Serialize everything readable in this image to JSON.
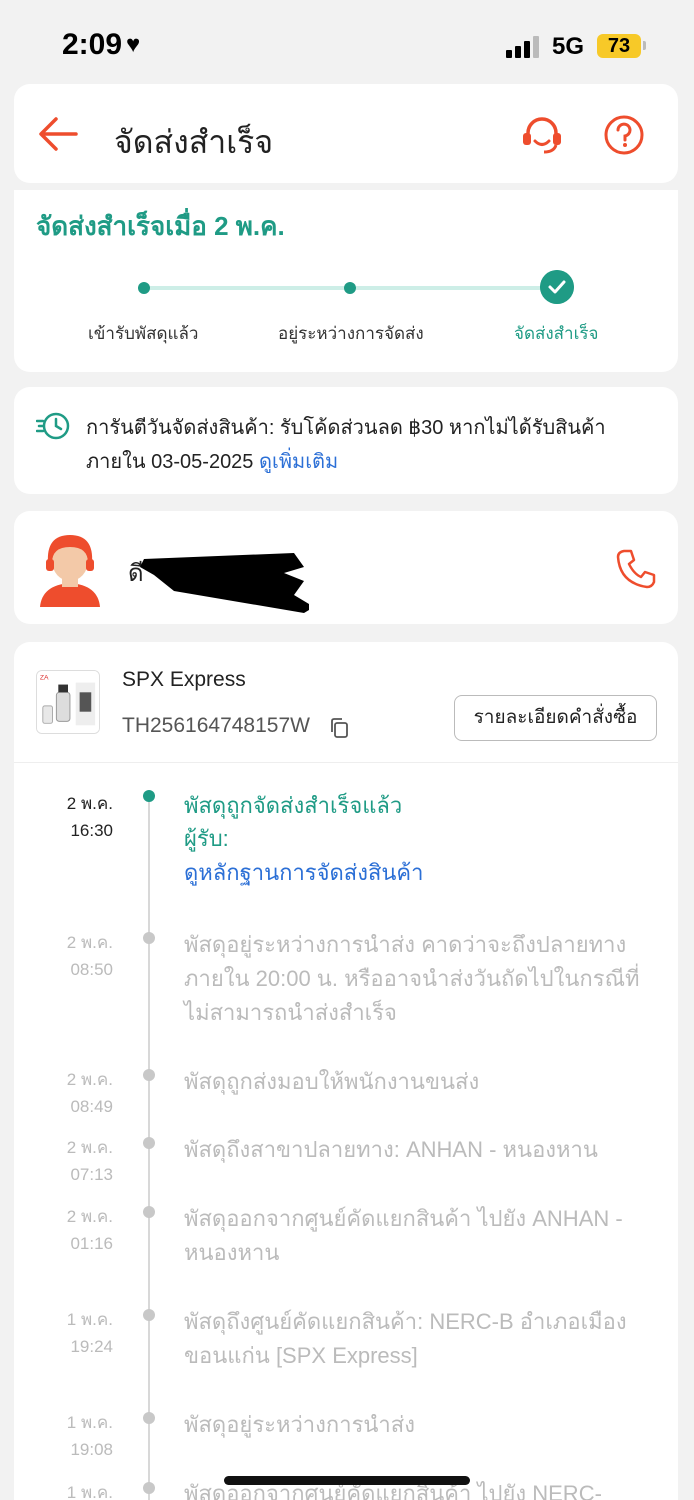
{
  "status_bar": {
    "time": "2:09",
    "network": "5G",
    "battery": "73"
  },
  "header": {
    "title": "จัดส่งสำเร็จ"
  },
  "delivery_status": {
    "headline": "จัดส่งสำเร็จเมื่อ 2 พ.ค.",
    "steps": [
      "เข้ารับพัสดุแล้ว",
      "อยู่ระหว่างการจัดส่ง",
      "จัดส่งสำเร็จ"
    ]
  },
  "guarantee": {
    "text": "การันตีวันจัดส่งสินค้า: รับโค้ดส่วนลด ฿30 หากไม่ได้รับสินค้าภายใน 03-05-2025",
    "link": "ดูเพิ่มเติม"
  },
  "driver": {
    "name": "ดี"
  },
  "shipment": {
    "carrier": "SPX Express",
    "tracking_number": "TH256164748157W",
    "order_details_button": "รายละเอียดคำสั่งซื้อ"
  },
  "timeline": [
    {
      "date": "2 พ.ค.",
      "time": "16:30",
      "desc": "พัสดุถูกจัดส่งสำเร็จแล้ว",
      "receiver": "ผู้รับ:",
      "proof_link": "ดูหลักฐานการจัดส่งสินค้า"
    },
    {
      "date": "2 พ.ค.",
      "time": "08:50",
      "desc": "พัสดุอยู่ระหว่างการนำส่ง คาดว่าจะถึงปลายทางภายใน 20:00 น. หรืออาจนำส่งวันถัดไปในกรณีที่ไม่สามารถนำส่งสำเร็จ"
    },
    {
      "date": "2 พ.ค.",
      "time": "08:49",
      "desc": "พัสดุถูกส่งมอบให้พนักงานขนส่ง"
    },
    {
      "date": "2 พ.ค.",
      "time": "07:13",
      "desc": "พัสดุถึงสาขาปลายทาง: ANHAN - หนองหาน"
    },
    {
      "date": "2 พ.ค.",
      "time": "01:16",
      "desc": "พัสดุออกจากศูนย์คัดแยกสินค้า ไปยัง ANHAN - หนองหาน"
    },
    {
      "date": "1 พ.ค.",
      "time": "19:24",
      "desc": "พัสดุถึงศูนย์คัดแยกสินค้า: NERC-B อำเภอเมืองขอนแก่น [SPX Express]"
    },
    {
      "date": "1 พ.ค.",
      "time": "19:08",
      "desc": "พัสดุอยู่ระหว่างการนำส่ง"
    },
    {
      "date": "1 พ.ค.",
      "time": "",
      "desc": "พัสดุออกจากศูนย์คัดแยกสินค้า ไปยัง NERC-"
    }
  ]
}
